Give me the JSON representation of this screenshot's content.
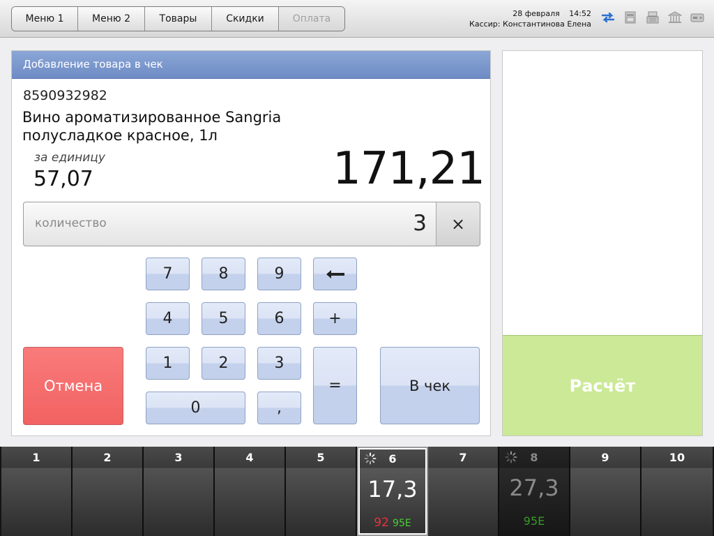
{
  "menu": {
    "items": [
      {
        "label": "Меню 1",
        "enabled": true
      },
      {
        "label": "Меню 2",
        "enabled": true
      },
      {
        "label": "Товары",
        "enabled": true
      },
      {
        "label": "Скидки",
        "enabled": true
      },
      {
        "label": "Оплата",
        "enabled": false
      }
    ]
  },
  "header": {
    "date": "28 февраля",
    "time": "14:52",
    "cashier": "Кассир: Константинова Елена",
    "icons": [
      "sync-arrows-icon",
      "printer-icon",
      "cash-register-icon",
      "bank-icon",
      "card-reader-icon"
    ]
  },
  "dialog": {
    "title": "Добавление товара в чек",
    "barcode": "8590932982",
    "product_line1": "Вино ароматизированное Sangria",
    "product_line2": "полусладкое красное, 1л",
    "unit_label": "за единицу",
    "unit_price": "57,07",
    "total": "171,21",
    "quantity_placeholder": "количество",
    "quantity_value": "3",
    "clear_label": "×"
  },
  "keypad": {
    "k7": "7",
    "k8": "8",
    "k9": "9",
    "backspace": "←",
    "k4": "4",
    "k5": "5",
    "k6": "6",
    "plus": "+",
    "k1": "1",
    "k2": "2",
    "k3": "3",
    "equals": "=",
    "k0": "0",
    "comma": ",",
    "cancel": "Отмена",
    "add_to_receipt": "В чек"
  },
  "payment": {
    "button": "Расчёт"
  },
  "pumps": [
    {
      "number": "1"
    },
    {
      "number": "2"
    },
    {
      "number": "3"
    },
    {
      "number": "4"
    },
    {
      "number": "5"
    },
    {
      "number": "6",
      "volume": "17,3",
      "fuel_a": "92",
      "fuel_b": "95E"
    },
    {
      "number": "7"
    },
    {
      "number": "8",
      "volume": "27,3",
      "fuel_b": "95E"
    },
    {
      "number": "9"
    },
    {
      "number": "10"
    }
  ],
  "colors": {
    "header_blue": "#7a97cd",
    "cancel_red": "#f46767",
    "pay_green": "#cbe996",
    "fuel92_red": "#e8323a",
    "fuel95_green": "#4ad034"
  }
}
